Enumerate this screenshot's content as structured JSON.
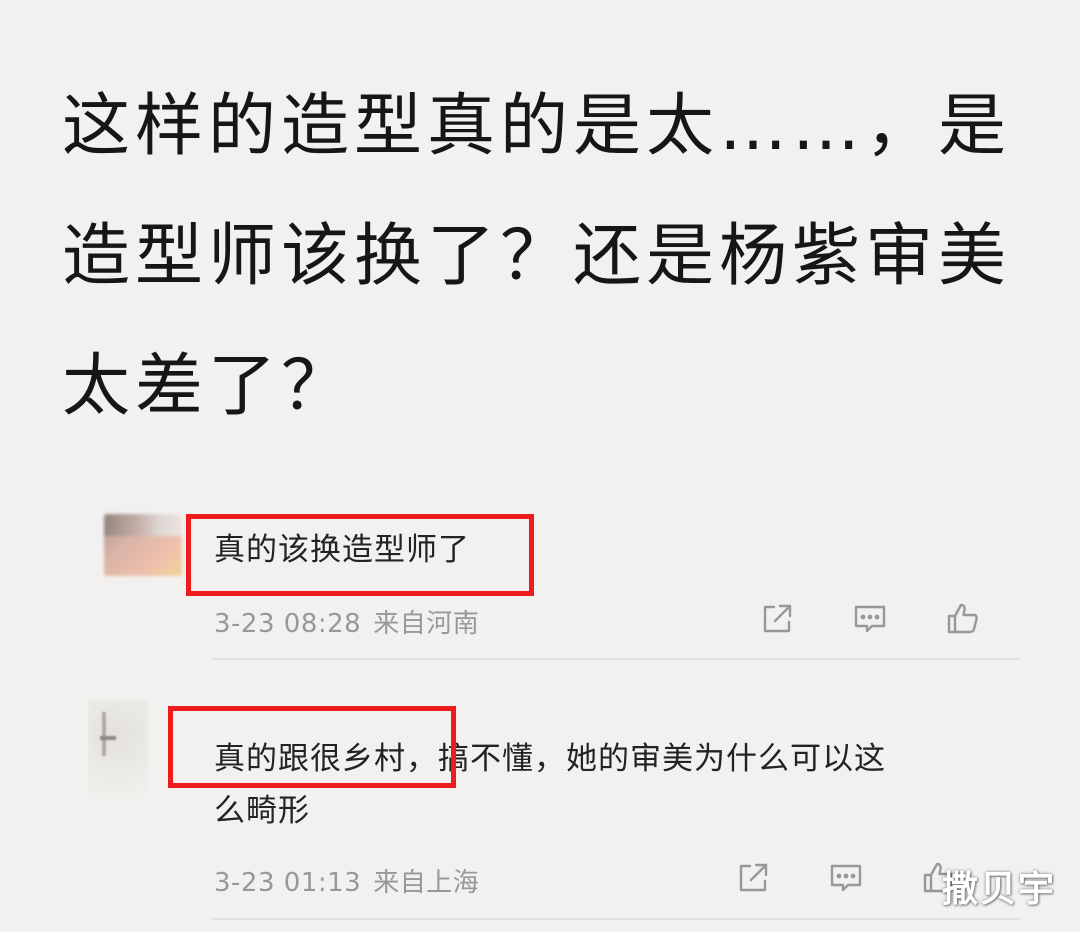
{
  "post": {
    "headline": "这样的造型真的是太……，是造型师该换了？还是杨紫审美太差了？"
  },
  "comments": [
    {
      "text": "真的该换造型师了",
      "time": "3-23 08:28",
      "location": "来自河南",
      "icons": [
        "share-icon",
        "comment-icon",
        "like-icon"
      ]
    },
    {
      "text_line1": "真的跟很乡村，搞不懂，她的审美为什么可以这",
      "text_line2": "么畸形",
      "time": "3-23 01:13",
      "location": "来自上海",
      "icons": [
        "share-icon",
        "comment-icon",
        "like-icon"
      ]
    }
  ],
  "watermark": "撒贝宇",
  "colors": {
    "background": "#f3f1ef",
    "highlight": "#ee1c1c",
    "meta_text": "#9a9896"
  }
}
